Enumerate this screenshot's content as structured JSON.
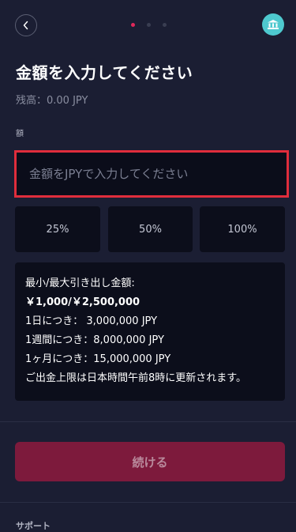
{
  "header": {
    "back_icon": "chevron-left-icon",
    "bank_icon": "bank-icon",
    "step_count": 3,
    "active_step": 1
  },
  "title": "金額を入力してください",
  "balance": "残高：0.00 JPY",
  "amount_label": "額",
  "amount_input": {
    "value": "",
    "placeholder": "金額をJPYで入力してください"
  },
  "presets": [
    "25%",
    "50%",
    "100%"
  ],
  "info": {
    "lines": [
      "最小/最大引き出し金額:",
      "￥1,000/￥2,500,000",
      "1日につき：  3,000,000 JPY",
      "1週間につき：8,000,000 JPY",
      "1ヶ月につき：15,000,000 JPY",
      "ご出金上限は日本時間午前8時に更新されます。"
    ]
  },
  "continue_label": "続ける",
  "support_label": "サポート",
  "colors": {
    "background": "#1b1e33",
    "accent": "#e0285a",
    "bank_icon_bg": "#4ec9cf",
    "input_border": "#e02d3c",
    "button_disabled": "#7d1a3c"
  }
}
